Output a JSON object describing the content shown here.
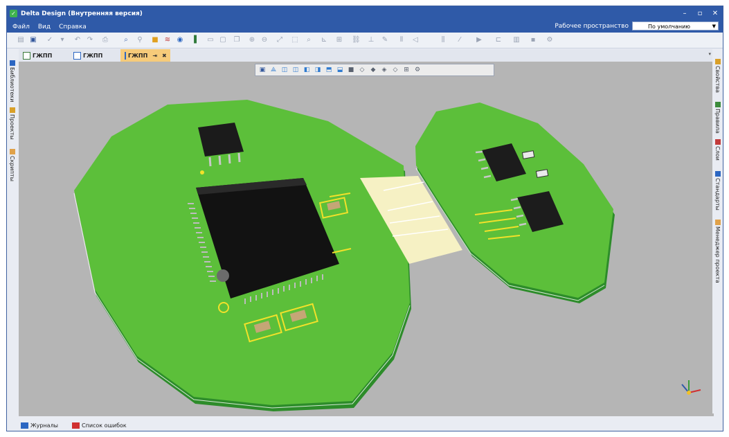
{
  "window": {
    "title": "Delta Design (Внутренняя версия)",
    "controls": {
      "minimize": "–",
      "restore": "▫",
      "close": "✕"
    }
  },
  "menu": {
    "items": [
      "Файл",
      "Вид",
      "Справка"
    ],
    "workspace_label": "Рабочее пространство",
    "workspace_value": "По умолчанию"
  },
  "doc_tabs": [
    {
      "label": "ГЖПП",
      "active": false
    },
    {
      "label": "ГЖПП",
      "active": false
    },
    {
      "label": "ГЖПП",
      "active": true,
      "pin": "⇥",
      "close": "✖"
    }
  ],
  "left_panel": [
    "Библиотеки",
    "Проекты",
    "Скрипты"
  ],
  "right_panel": [
    "Свойства",
    "Правила",
    "Слои",
    "Стандарты",
    "Менеджер проекта"
  ],
  "bottom_tabs": [
    "Журналы",
    "Список ошибок"
  ],
  "colors": {
    "title_bar": "#2f5aa8",
    "pcb_green": "#5cbf3a",
    "silkscreen": "#f2e12a",
    "flex": "#f6f1c4",
    "ic_black": "#121212",
    "active_tab": "#f6cb7a",
    "canvas_bg": "#b5b5b5"
  }
}
